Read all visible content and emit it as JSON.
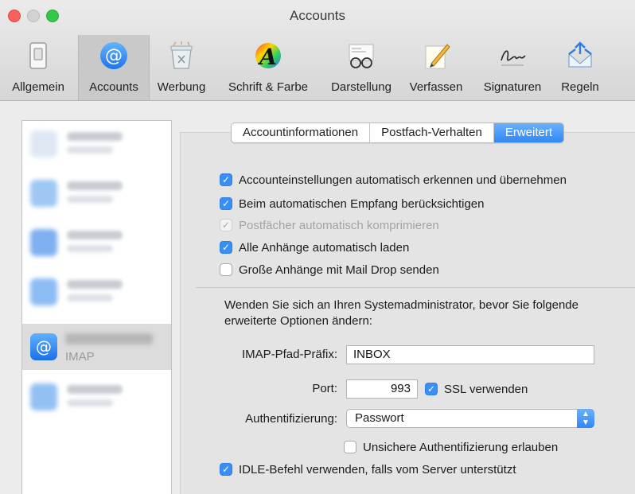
{
  "window": {
    "title": "Accounts"
  },
  "toolbar": {
    "items": [
      {
        "label": "Allgemein",
        "icon": "switch-icon"
      },
      {
        "label": "Accounts",
        "icon": "at-sign-icon",
        "selected": true
      },
      {
        "label": "Werbung",
        "icon": "trash-icon"
      },
      {
        "label": "Schrift & Farbe",
        "icon": "font-color-icon"
      },
      {
        "label": "Darstellung",
        "icon": "glasses-icon"
      },
      {
        "label": "Verfassen",
        "icon": "pencil-paper-icon"
      },
      {
        "label": "Signaturen",
        "icon": "signature-icon"
      },
      {
        "label": "Regeln",
        "icon": "rules-envelope-icon"
      }
    ]
  },
  "accounts": {
    "selected_type": "IMAP"
  },
  "tabs": [
    {
      "label": "Accountinformationen",
      "active": false
    },
    {
      "label": "Postfach-Verhalten",
      "active": false
    },
    {
      "label": "Erweitert",
      "active": true
    }
  ],
  "options": [
    {
      "label": "Accounteinstellungen automatisch erkennen und übernehmen",
      "checked": true,
      "enabled": true
    },
    {
      "label": "Beim automatischen Empfang berücksichtigen",
      "checked": true,
      "enabled": true
    },
    {
      "label": "Postfächer automatisch komprimieren",
      "checked": true,
      "enabled": false
    },
    {
      "label": "Alle Anhänge automatisch laden",
      "checked": true,
      "enabled": true
    },
    {
      "label": "Große Anhänge mit Mail Drop senden",
      "checked": false,
      "enabled": true
    }
  ],
  "advanced": {
    "note": "Wenden Sie sich an Ihren Systemadministrator, bevor Sie folgende erweiterte Optionen ändern:",
    "imap_prefix_label": "IMAP-Pfad-Präfix:",
    "imap_prefix_value": "INBOX",
    "port_label": "Port:",
    "port_value": "993",
    "ssl_label": "SSL verwenden",
    "auth_label": "Authentifizierung:",
    "auth_value": "Passwort",
    "insecure_auth_label": "Unsichere Authentifizierung erlauben",
    "idle_label": "IDLE-Befehl verwenden, falls vom Server unterstützt"
  },
  "colors": {
    "accent": "#3a8ff7"
  }
}
